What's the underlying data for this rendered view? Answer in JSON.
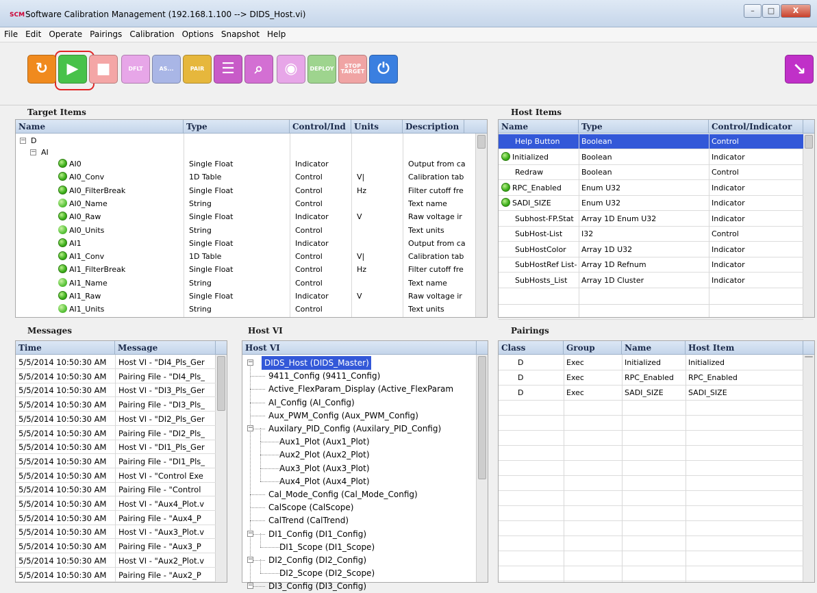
{
  "window": {
    "title": "Software Calibration Management (192.168.1.100 --> DIDS_Host.vi)",
    "app_icon": "SCM",
    "minimize": "–",
    "maximize": "□",
    "close": "X"
  },
  "menu": [
    "File",
    "Edit",
    "Operate",
    "Pairings",
    "Calibration",
    "Options",
    "Snapshot",
    "Help"
  ],
  "toolbar": {
    "buttons": [
      {
        "icon": "refresh-icon",
        "label": "↻",
        "color": "#f08a1e"
      },
      {
        "icon": "run-icon",
        "label": "▶",
        "color": "#48c24a"
      },
      {
        "icon": "stop-icon",
        "label": "■",
        "color": "#f4a6a6"
      },
      {
        "icon": "save-default-icon",
        "label": "DFLT",
        "color": "#e7a6e8"
      },
      {
        "icon": "save-as-icon",
        "label": "AS...",
        "color": "#a9b6e6"
      },
      {
        "icon": "save-pair-icon",
        "label": "PAIR",
        "color": "#e6b73c"
      },
      {
        "icon": "file-icon",
        "label": "☰",
        "color": "#c85bc8"
      },
      {
        "icon": "search-icon",
        "label": "⌕",
        "color": "#d36fd3"
      },
      {
        "icon": "camera-icon",
        "label": "◉",
        "color": "#e7a6e8"
      },
      {
        "icon": "deploy-icon",
        "label": "DEPLOY",
        "color": "#9ed48e"
      },
      {
        "icon": "stop-target-icon",
        "label": "STOP TARGET",
        "color": "#f0a4a4"
      },
      {
        "icon": "power-icon",
        "label": "⏻",
        "color": "#3a7fe0"
      }
    ],
    "exit_icon": "↘"
  },
  "target_items": {
    "title": "Target Items",
    "columns": [
      "Name",
      "Type",
      "Control/Ind",
      "Units",
      "Description"
    ],
    "tree": [
      {
        "label": "D",
        "depth": 0
      },
      {
        "label": "AI",
        "depth": 1
      }
    ],
    "rows": [
      {
        "name": "AI0",
        "type": "Single Float",
        "ci": "Indicator",
        "units": "",
        "desc": "Output from ca",
        "led": "led"
      },
      {
        "name": "AI0_Conv",
        "type": "1D Table",
        "ci": "Control",
        "units": "V|",
        "desc": "Calibration tab",
        "led": "led"
      },
      {
        "name": "AI0_FilterBreak",
        "type": "Single Float",
        "ci": "Control",
        "units": "Hz",
        "desc": "Filter cutoff fre",
        "led": "led"
      },
      {
        "name": "AI0_Name",
        "type": "String",
        "ci": "Control",
        "units": "",
        "desc": "Text name",
        "led": "tri"
      },
      {
        "name": "AI0_Raw",
        "type": "Single Float",
        "ci": "Indicator",
        "units": "V",
        "desc": "Raw voltage ir",
        "led": "led"
      },
      {
        "name": "AI0_Units",
        "type": "String",
        "ci": "Control",
        "units": "",
        "desc": "Text units",
        "led": "tri"
      },
      {
        "name": "AI1",
        "type": "Single Float",
        "ci": "Indicator",
        "units": "",
        "desc": "Output from ca",
        "led": "led"
      },
      {
        "name": "AI1_Conv",
        "type": "1D Table",
        "ci": "Control",
        "units": "V|",
        "desc": "Calibration tab",
        "led": "led"
      },
      {
        "name": "AI1_FilterBreak",
        "type": "Single Float",
        "ci": "Control",
        "units": "Hz",
        "desc": "Filter cutoff fre",
        "led": "led"
      },
      {
        "name": "AI1_Name",
        "type": "String",
        "ci": "Control",
        "units": "",
        "desc": "Text name",
        "led": "tri"
      },
      {
        "name": "AI1_Raw",
        "type": "Single Float",
        "ci": "Indicator",
        "units": "V",
        "desc": "Raw voltage ir",
        "led": "led"
      },
      {
        "name": "AI1_Units",
        "type": "String",
        "ci": "Control",
        "units": "",
        "desc": "Text units",
        "led": "tri"
      }
    ]
  },
  "host_items": {
    "title": "Host Items",
    "columns": [
      "Name",
      "Type",
      "Control/Indicator"
    ],
    "rows": [
      {
        "name": "Help Button",
        "type": "Boolean",
        "ci": "Control",
        "led": "",
        "selected": true
      },
      {
        "name": "Initialized",
        "type": "Boolean",
        "ci": "Indicator",
        "led": "led"
      },
      {
        "name": "Redraw",
        "type": "Boolean",
        "ci": "Control",
        "led": ""
      },
      {
        "name": "RPC_Enabled",
        "type": "Enum U32",
        "ci": "Indicator",
        "led": "led"
      },
      {
        "name": "SADI_SIZE",
        "type": "Enum U32",
        "ci": "Indicator",
        "led": "led"
      },
      {
        "name": "Subhost-FP.Stat",
        "type": "Array 1D Enum U32",
        "ci": "Indicator",
        "led": ""
      },
      {
        "name": "SubHost-List",
        "type": "I32",
        "ci": "Control",
        "led": ""
      },
      {
        "name": "SubHostColor",
        "type": "Array 1D U32",
        "ci": "Indicator",
        "led": ""
      },
      {
        "name": "SubHostRef List-",
        "type": "Array 1D Refnum",
        "ci": "Indicator",
        "led": ""
      },
      {
        "name": "SubHosts_List",
        "type": "Array 1D Cluster",
        "ci": "Indicator",
        "led": ""
      }
    ]
  },
  "messages": {
    "title": "Messages",
    "columns": [
      "Time",
      "Message"
    ],
    "rows": [
      [
        "5/5/2014 10:50:30 AM",
        "Host VI - \"DI4_Pls_Ger"
      ],
      [
        "5/5/2014 10:50:30 AM",
        "Pairing File - \"DI4_Pls_"
      ],
      [
        "5/5/2014 10:50:30 AM",
        "Host VI - \"DI3_Pls_Ger"
      ],
      [
        "5/5/2014 10:50:30 AM",
        "Pairing File - \"DI3_Pls_"
      ],
      [
        "5/5/2014 10:50:30 AM",
        "Host VI - \"DI2_Pls_Ger"
      ],
      [
        "5/5/2014 10:50:30 AM",
        "Pairing File - \"DI2_Pls_"
      ],
      [
        "5/5/2014 10:50:30 AM",
        "Host VI - \"DI1_Pls_Ger"
      ],
      [
        "5/5/2014 10:50:30 AM",
        "Pairing File - \"DI1_Pls_"
      ],
      [
        "5/5/2014 10:50:30 AM",
        "Host VI - \"Control Exe"
      ],
      [
        "5/5/2014 10:50:30 AM",
        "Pairing File - \"Control"
      ],
      [
        "5/5/2014 10:50:30 AM",
        "Host VI - \"Aux4_Plot.v"
      ],
      [
        "5/5/2014 10:50:30 AM",
        "Pairing File - \"Aux4_P"
      ],
      [
        "5/5/2014 10:50:30 AM",
        "Host VI - \"Aux3_Plot.v"
      ],
      [
        "5/5/2014 10:50:30 AM",
        "Pairing File - \"Aux3_P"
      ],
      [
        "5/5/2014 10:50:30 AM",
        "Host VI - \"Aux2_Plot.v"
      ],
      [
        "5/5/2014 10:50:30 AM",
        "Pairing File - \"Aux2_P"
      ]
    ]
  },
  "host_vi": {
    "title": "Host VI",
    "column": "Host VI",
    "nodes": [
      {
        "label": "DIDS_Host (DIDS_Master)",
        "depth": 0,
        "expander": "−",
        "selected": true
      },
      {
        "label": "9411_Config (9411_Config)",
        "depth": 1
      },
      {
        "label": "Active_FlexParam_Display (Active_FlexParam",
        "depth": 1
      },
      {
        "label": "AI_Config (AI_Config)",
        "depth": 1
      },
      {
        "label": "Aux_PWM_Config (Aux_PWM_Config)",
        "depth": 1
      },
      {
        "label": "Auxilary_PID_Config (Auxilary_PID_Config)",
        "depth": 1,
        "expander": "−"
      },
      {
        "label": "Aux1_Plot (Aux1_Plot)",
        "depth": 2
      },
      {
        "label": "Aux2_Plot (Aux2_Plot)",
        "depth": 2
      },
      {
        "label": "Aux3_Plot (Aux3_Plot)",
        "depth": 2
      },
      {
        "label": "Aux4_Plot (Aux4_Plot)",
        "depth": 2
      },
      {
        "label": "Cal_Mode_Config (Cal_Mode_Config)",
        "depth": 1
      },
      {
        "label": "CalScope (CalScope)",
        "depth": 1
      },
      {
        "label": "CalTrend (CalTrend)",
        "depth": 1
      },
      {
        "label": "DI1_Config (DI1_Config)",
        "depth": 1,
        "expander": "−"
      },
      {
        "label": "DI1_Scope (DI1_Scope)",
        "depth": 2
      },
      {
        "label": "DI2_Config (DI2_Config)",
        "depth": 1,
        "expander": "−"
      },
      {
        "label": "DI2_Scope (DI2_Scope)",
        "depth": 2
      },
      {
        "label": "DI3_Config (DI3_Config)",
        "depth": 1,
        "expander": "−"
      }
    ]
  },
  "pairings": {
    "title": "Pairings",
    "columns": [
      "Class",
      "Group",
      "Name",
      "Host Item"
    ],
    "rows": [
      [
        "D",
        "Exec",
        "Initialized",
        "Initialized"
      ],
      [
        "D",
        "Exec",
        "RPC_Enabled",
        "RPC_Enabled"
      ],
      [
        "D",
        "Exec",
        "SADI_SIZE",
        "SADI_SIZE"
      ]
    ]
  }
}
